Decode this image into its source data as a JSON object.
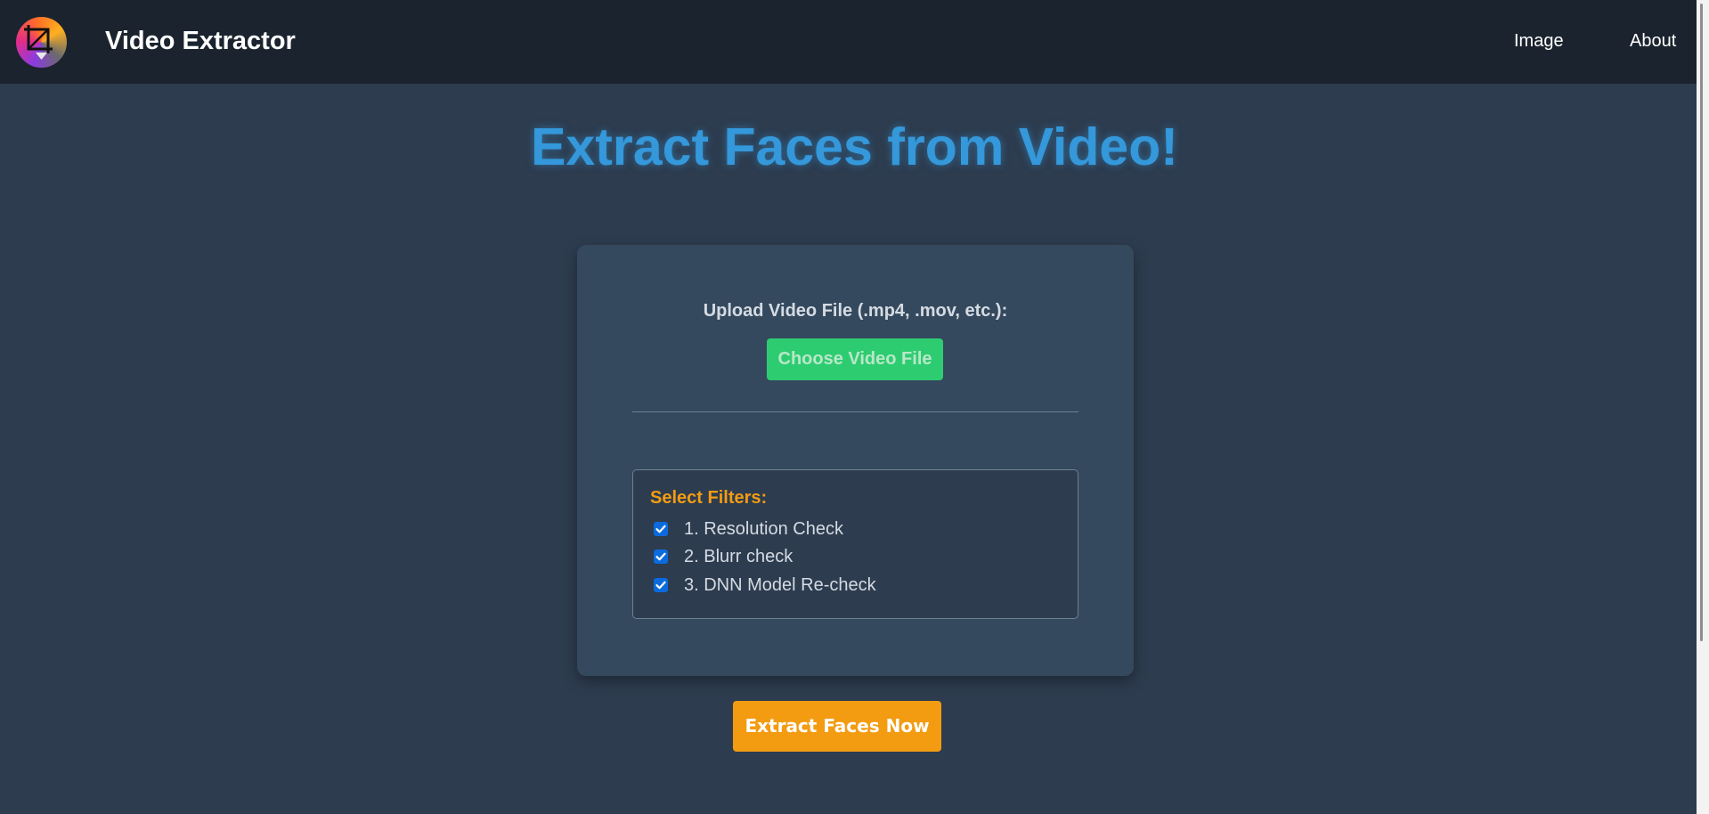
{
  "app": {
    "brand_title": "Video Extractor",
    "logo_icon": "crop-download-icon"
  },
  "nav": {
    "items": [
      {
        "label": "Image"
      },
      {
        "label": "About"
      }
    ]
  },
  "main": {
    "title": "Extract Faces from Video!",
    "upload_label": "Upload Video File (.mp4, .mov, etc.):",
    "choose_button": "Choose Video File",
    "filters": {
      "title": "Select Filters:",
      "items": [
        {
          "label": "1. Resolution Check",
          "checked": true
        },
        {
          "label": "2. Blurr check",
          "checked": true
        },
        {
          "label": "3. DNN Model Re-check",
          "checked": true
        }
      ]
    },
    "extract_button": "Extract Faces Now"
  },
  "colors": {
    "background": "#2d3c4f",
    "navbar": "#1a232e",
    "card": "#34495e",
    "title_blue": "#3498db",
    "button_green": "#2ecc71",
    "accent_orange": "#f39c12",
    "checkbox_blue": "#0b6bde"
  }
}
